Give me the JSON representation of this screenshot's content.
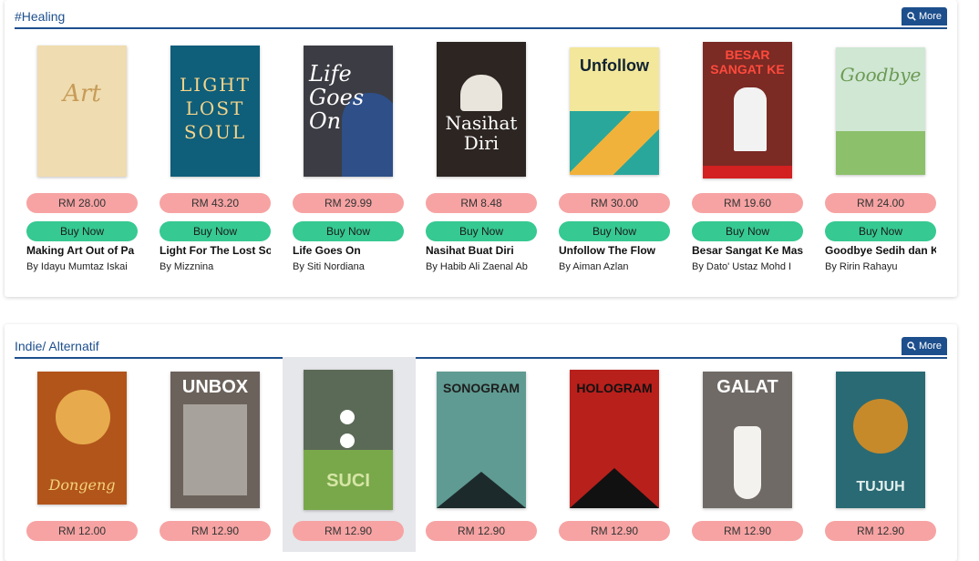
{
  "sections": [
    {
      "title": "#Healing",
      "more_label": "More",
      "books": [
        {
          "title": "Making Art Out of Pa",
          "author": "By Idayu Mumtaz Iskai",
          "price": "RM 28.00",
          "buy": "Buy Now",
          "cover_color": "#efdcb0",
          "cover_text": "Art"
        },
        {
          "title": "Light For The Lost So",
          "author": "By Mizznina",
          "price": "RM 43.20",
          "buy": "Buy Now",
          "cover_color": "#0f5e7a",
          "cover_text": "LIGHT LOST SOUL"
        },
        {
          "title": "Life Goes On",
          "author": "By Siti Nordiana",
          "price": "RM 29.99",
          "buy": "Buy Now",
          "cover_color": "#3c3c44",
          "cover_text": "Life Goes On"
        },
        {
          "title": "Nasihat Buat Diri",
          "author": "By Habib Ali Zaenal Ab",
          "price": "RM 8.48",
          "buy": "Buy Now",
          "cover_color": "#2c2522",
          "cover_text": "Nasihat Diri"
        },
        {
          "title": "Unfollow The Flow",
          "author": "By Aiman Azlan",
          "price": "RM 30.00",
          "buy": "Buy Now",
          "cover_color": "#f2e79a",
          "cover_text": "Unfollow"
        },
        {
          "title": "Besar Sangat Ke Mas",
          "author": "By Dato' Ustaz Mohd I",
          "price": "RM 19.60",
          "buy": "Buy Now",
          "cover_color": "#7b2a24",
          "cover_text": "BESAR SANGAT KE"
        },
        {
          "title": "Goodbye Sedih dan K",
          "author": "By Ririn Rahayu",
          "price": "RM 24.00",
          "buy": "Buy Now",
          "cover_color": "#cfe7d3",
          "cover_text": "Goodbye"
        }
      ]
    },
    {
      "title": "Indie/ Alternatif",
      "more_label": "More",
      "books": [
        {
          "title": "",
          "author": "",
          "price": "RM 12.00",
          "buy": "",
          "cover_color": "#b2551b",
          "cover_text": "Dongeng"
        },
        {
          "title": "",
          "author": "",
          "price": "RM 12.90",
          "buy": "",
          "cover_color": "#6b625b",
          "cover_text": "UNBOX"
        },
        {
          "title": "",
          "author": "",
          "price": "RM 12.90",
          "buy": "",
          "cover_color": "#5b6a57",
          "cover_text": "SUCI"
        },
        {
          "title": "",
          "author": "",
          "price": "RM 12.90",
          "buy": "",
          "cover_color": "#5f9b92",
          "cover_text": "SONOGRAM"
        },
        {
          "title": "",
          "author": "",
          "price": "RM 12.90",
          "buy": "",
          "cover_color": "#b8201c",
          "cover_text": "HOLOGRAM"
        },
        {
          "title": "",
          "author": "",
          "price": "RM 12.90",
          "buy": "",
          "cover_color": "#6f6a66",
          "cover_text": "GALAT"
        },
        {
          "title": "",
          "author": "",
          "price": "RM 12.90",
          "buy": "",
          "cover_color": "#2a6a74",
          "cover_text": "TUJUH"
        }
      ]
    }
  ]
}
